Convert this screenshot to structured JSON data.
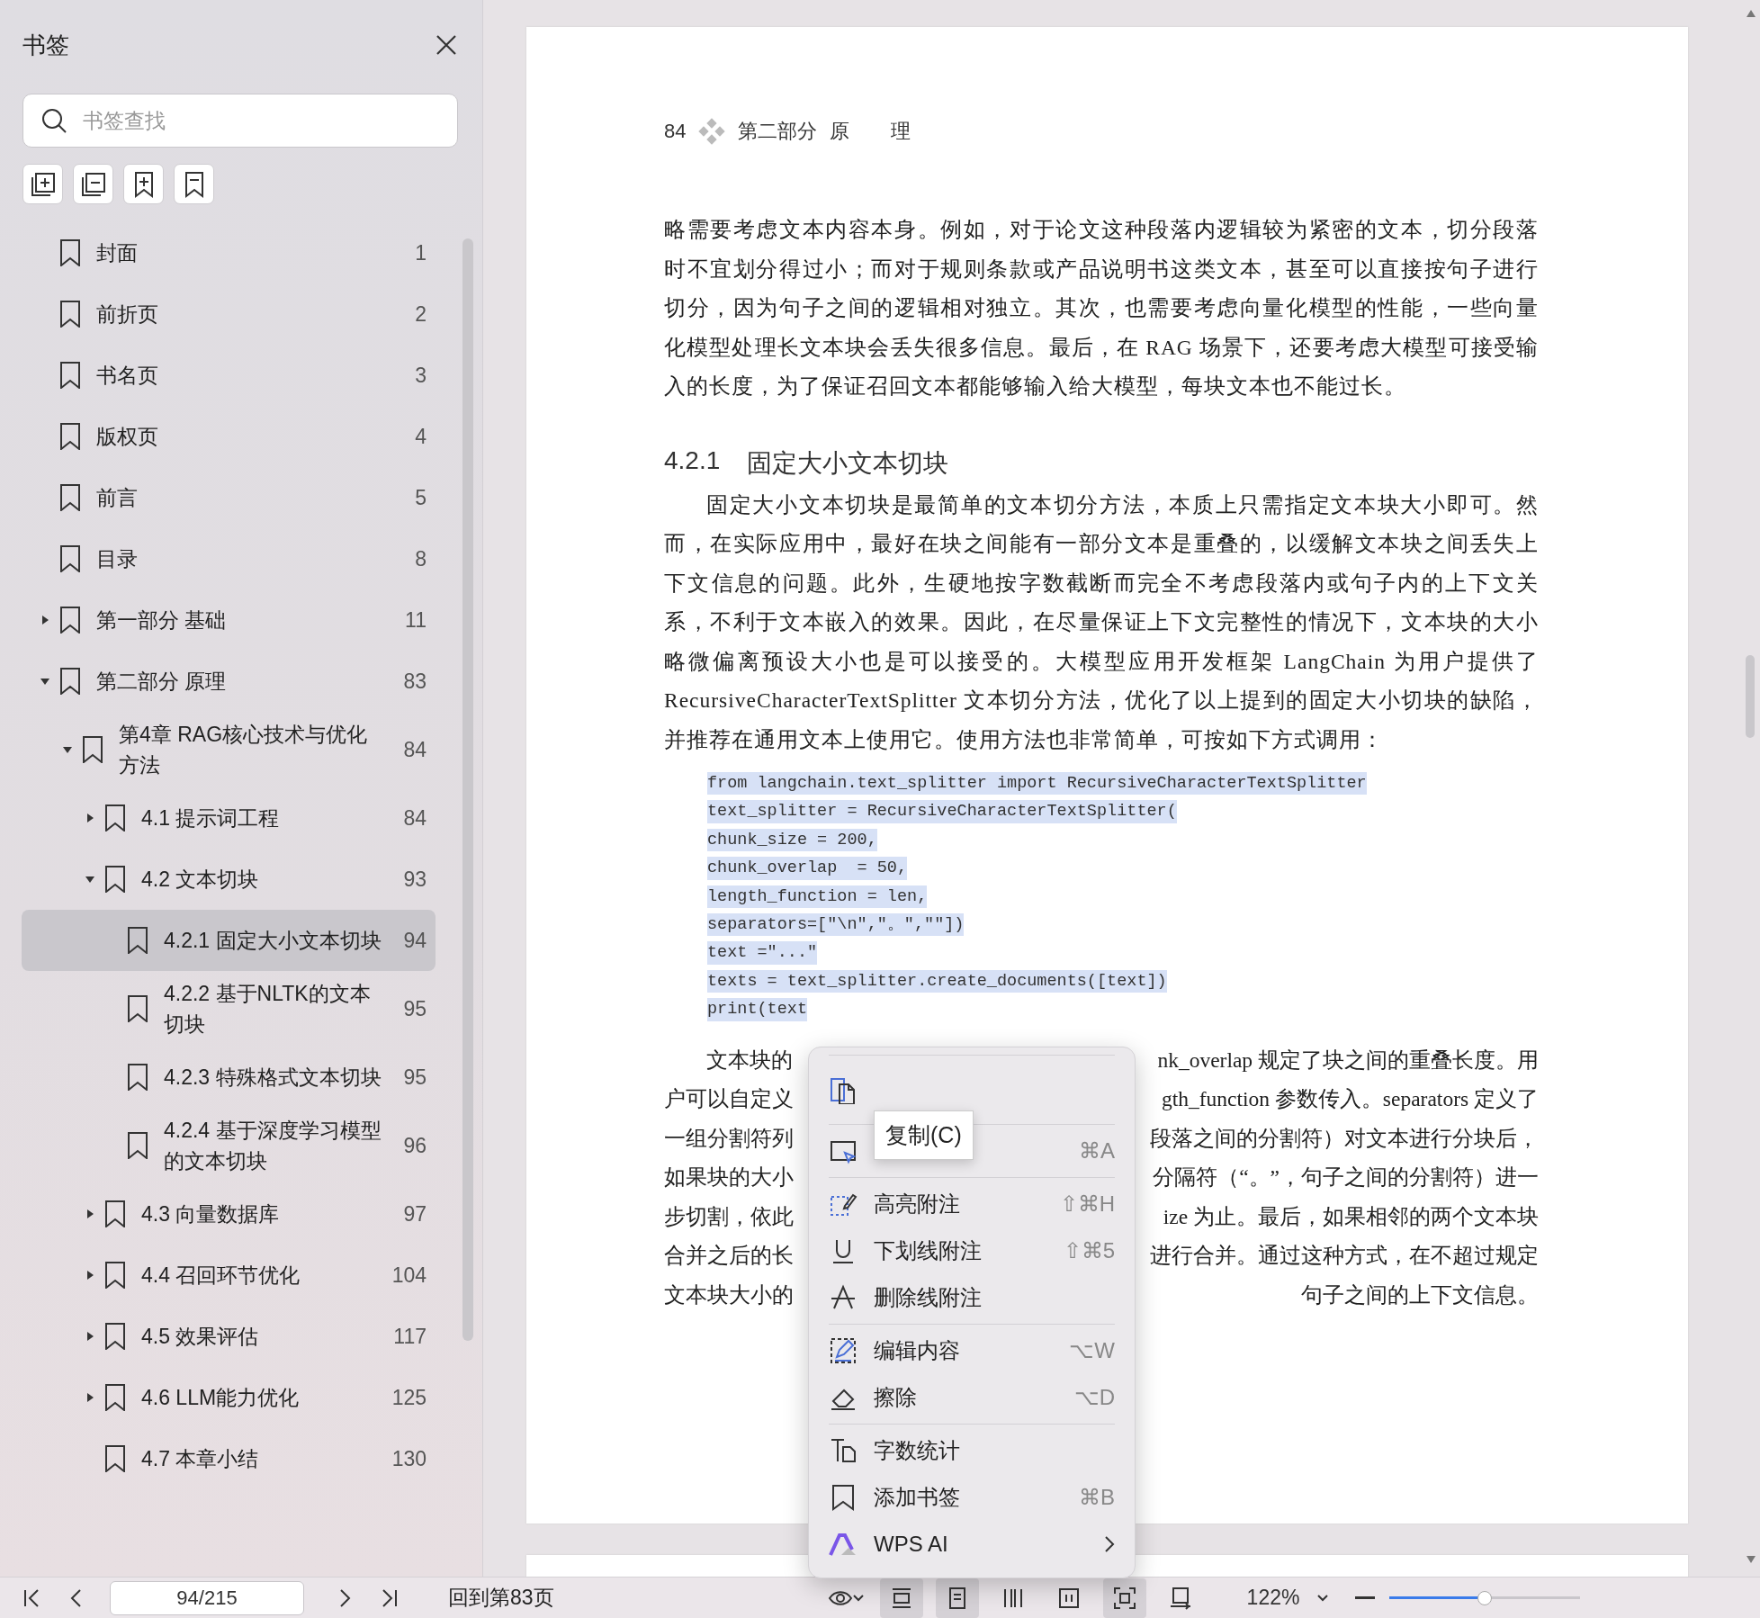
{
  "sidebar": {
    "title": "书签",
    "search": {
      "placeholder": "书签查找"
    },
    "items": [
      {
        "label": "封面",
        "page": "1",
        "selected": false
      },
      {
        "label": "前折页",
        "page": "2",
        "selected": false
      },
      {
        "label": "书名页",
        "page": "3",
        "selected": false
      },
      {
        "label": "版权页",
        "page": "4",
        "selected": false
      },
      {
        "label": "前言",
        "page": "5",
        "selected": false
      },
      {
        "label": "目录",
        "page": "8",
        "selected": false
      },
      {
        "label": "第一部分 基础",
        "page": "11",
        "selected": false,
        "expanded": false
      },
      {
        "label": "第二部分 原理",
        "page": "83",
        "selected": false,
        "expanded": true,
        "children": [
          {
            "label": "第4章 RAG核心技术与优化方法",
            "page": "84",
            "selected": false,
            "expanded": true,
            "children": [
              {
                "label": "4.1 提示词工程",
                "page": "84",
                "selected": false,
                "expanded": false
              },
              {
                "label": "4.2 文本切块",
                "page": "93",
                "selected": false,
                "expanded": true,
                "children": [
                  {
                    "label": "4.2.1 固定大小文本切块",
                    "page": "94",
                    "selected": true
                  },
                  {
                    "label": "4.2.2 基于NLTK的文本切块",
                    "page": "95",
                    "selected": false
                  },
                  {
                    "label": "4.2.3 特殊格式文本切块",
                    "page": "95",
                    "selected": false
                  },
                  {
                    "label": "4.2.4 基于深度学习模型的文本切块",
                    "page": "96",
                    "selected": false
                  }
                ]
              },
              {
                "label": "4.3 向量数据库",
                "page": "97",
                "selected": false,
                "expanded": false
              },
              {
                "label": "4.4 召回环节优化",
                "page": "104",
                "selected": false,
                "expanded": false
              },
              {
                "label": "4.5 效果评估",
                "page": "117",
                "selected": false,
                "expanded": false
              },
              {
                "label": "4.6 LLM能力优化",
                "page": "125",
                "selected": false,
                "expanded": false
              },
              {
                "label": "4.7 本章小结",
                "page": "130",
                "selected": false
              }
            ]
          }
        ]
      }
    ]
  },
  "page": {
    "header": {
      "number": "84",
      "part": "第二部分",
      "title": "原 理"
    },
    "paragraph_1": "略需要考虑文本内容本身。例如，对于论文这种段落内逻辑较为紧密的文本，切分段落时不宜划分得过小；而对于规则条款或产品说明书这类文本，甚至可以直接按句子进行切分，因为句子之间的逻辑相对独立。其次，也需要考虑向量化模型的性能，一些向量化模型处理长文本块会丢失很多信息。最后，在 RAG 场景下，还要考虑大模型可接受输入的长度，为了保证召回文本都能够输入给大模型，每块文本也不能过长。",
    "heading": {
      "number": "4.2.1",
      "title": "固定大小文本切块"
    },
    "paragraph_2": "固定大小文本切块是最简单的文本切分方法，本质上只需指定文本块大小即可。然而，在实际应用中，最好在块之间能有一部分文本是重叠的，以缓解文本块之间丢失上下文信息的问题。此外，生硬地按字数截断而完全不考虑段落内或句子内的上下文关系，不利于文本嵌入的效果。因此，在尽量保证上下文完整性的情况下，文本块的大小略微偏离预设大小也是可以接受的。大模型应用开发框架 LangChain 为用户提供了 RecursiveCharacterTextSplitter 文本切分方法，优化了以上提到的固定大小切块的缺陷，并推荐在通用文本上使用它。使用方法也非常简单，可按如下方式调用：",
    "code": {
      "selected": true,
      "lines": [
        "from langchain.text_splitter import RecursiveCharacterTextSplitter",
        "text_splitter = RecursiveCharacterTextSplitter(",
        "chunk_size = 200,",
        "chunk_overlap  = 50,",
        "length_function = len,",
        "separators=[\"\\n\",\"。\",\"\"])",
        "text =\"...\"",
        "texts = text_splitter.create_documents([text])",
        "print(text"
      ]
    },
    "paragraph_3_lines": [
      {
        "left": "文本块的",
        "right": "nk_overlap 规定了块之间的重叠长度。用"
      },
      {
        "left": "户可以自定义",
        "right": "gth_function 参数传入。separators 定义了"
      },
      {
        "left": "一组分割符列",
        "right": "段落之间的分割符）对文本进行分块后，"
      },
      {
        "left": "如果块的大小",
        "right": "分隔符（“。”，句子之间的分割符）进一"
      },
      {
        "left": "步切割，依此",
        "right": "ize 为止。最后，如果相邻的两个文本块"
      },
      {
        "left": "合并之后的长",
        "right": "进行合并。通过这种方式，在不超过规定"
      },
      {
        "left": "文本块大小的",
        "right": "句子之间的上下文信息。"
      }
    ]
  },
  "context_menu": {
    "tooltip": "复制(C)",
    "groups": [
      [
        {
          "kind": "icon"
        }
      ],
      [
        {
          "kind": "hidden",
          "shortcut": "⌘A"
        }
      ],
      [
        {
          "kind": "item",
          "label": "高亮附注",
          "shortcut": "⇧⌘H"
        },
        {
          "kind": "item",
          "label": "下划线附注",
          "shortcut": "⇧⌘5"
        },
        {
          "kind": "item",
          "label": "删除线附注"
        }
      ],
      [
        {
          "kind": "item",
          "label": "编辑内容",
          "shortcut": "⌥W"
        },
        {
          "kind": "item",
          "label": "擦除",
          "shortcut": "⌥D"
        }
      ],
      [
        {
          "kind": "item",
          "label": "字数统计"
        },
        {
          "kind": "item",
          "label": "添加书签",
          "shortcut": "⌘B"
        },
        {
          "kind": "submenu",
          "label": "WPS AI"
        }
      ]
    ]
  },
  "bottom_bar": {
    "page_field": "94/215",
    "back_link": "回到第83页",
    "view_buttons": [
      {
        "selected": false
      },
      {
        "selected": true
      },
      {
        "selected": true
      },
      {
        "selected": false
      },
      {
        "selected": false
      },
      {
        "selected": true
      },
      {
        "selected": false
      }
    ],
    "zoom": "122%",
    "zoom_slider": {
      "level": 0.5
    }
  }
}
